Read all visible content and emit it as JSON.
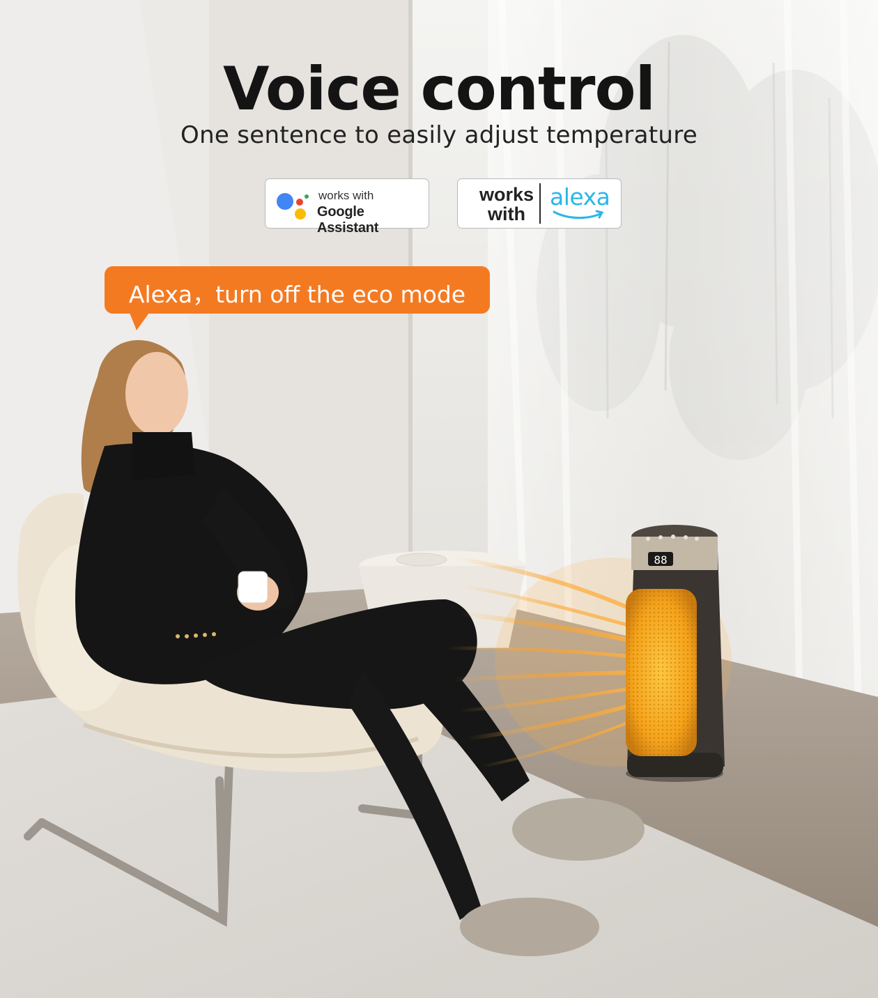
{
  "headline": "Voice control",
  "subheadline": "One sentence to easily adjust temperature",
  "badges": {
    "google": {
      "small_text": "works with",
      "name": "Google Assistant"
    },
    "alexa": {
      "works_text_line1": "works",
      "works_text_line2": "with",
      "logo_text": "alexa"
    }
  },
  "speech_bubble": {
    "text": "Alexa，turn off the eco mode",
    "color": "#f47a22"
  },
  "heater_display": "88",
  "colors": {
    "accent_orange": "#f47a22",
    "google_blue": "#4285F4",
    "google_red": "#EA4335",
    "google_yellow": "#FBBC05",
    "google_green": "#34A853",
    "alexa_blue": "#2bb6e8"
  }
}
